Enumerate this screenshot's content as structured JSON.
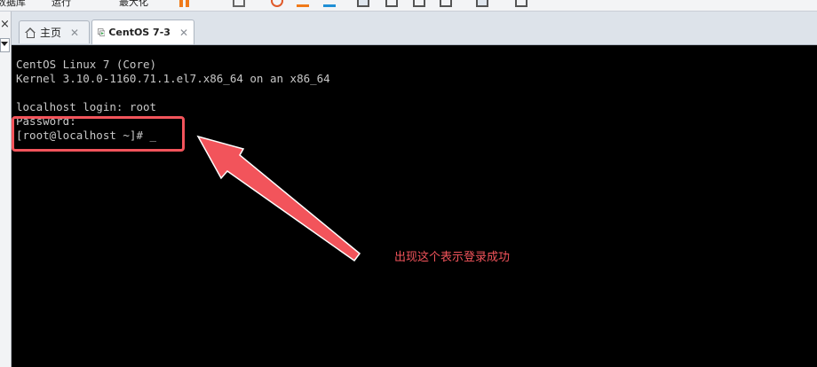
{
  "toolbar": {
    "items": [
      {
        "icon": "partial-text-1",
        "text": "数据库"
      },
      {
        "icon": "partial-text-2",
        "text": "运行"
      },
      {
        "icon": "partial-text-3",
        "text": "最大化"
      }
    ]
  },
  "tabs": [
    {
      "label": "主页",
      "icon": "home-icon",
      "close": "✕"
    },
    {
      "label": "CentOS 7-3",
      "icon": "vm-icon",
      "close": "✕"
    }
  ],
  "terminal": {
    "lines": [
      "CentOS Linux 7 (Core)",
      "Kernel 3.10.0-1160.71.1.el7.x86_64 on an x86_64",
      "",
      "localhost login: root",
      "Password:",
      "[root@localhost ~]# _"
    ]
  },
  "annotation": {
    "text": "出现这个表示登录成功",
    "color": "#f2545b"
  },
  "colors": {
    "terminal_bg": "#000000",
    "terminal_fg": "#c8c8c8",
    "accent_red": "#f2545b",
    "vm_icon_green": "#3aa24a"
  }
}
